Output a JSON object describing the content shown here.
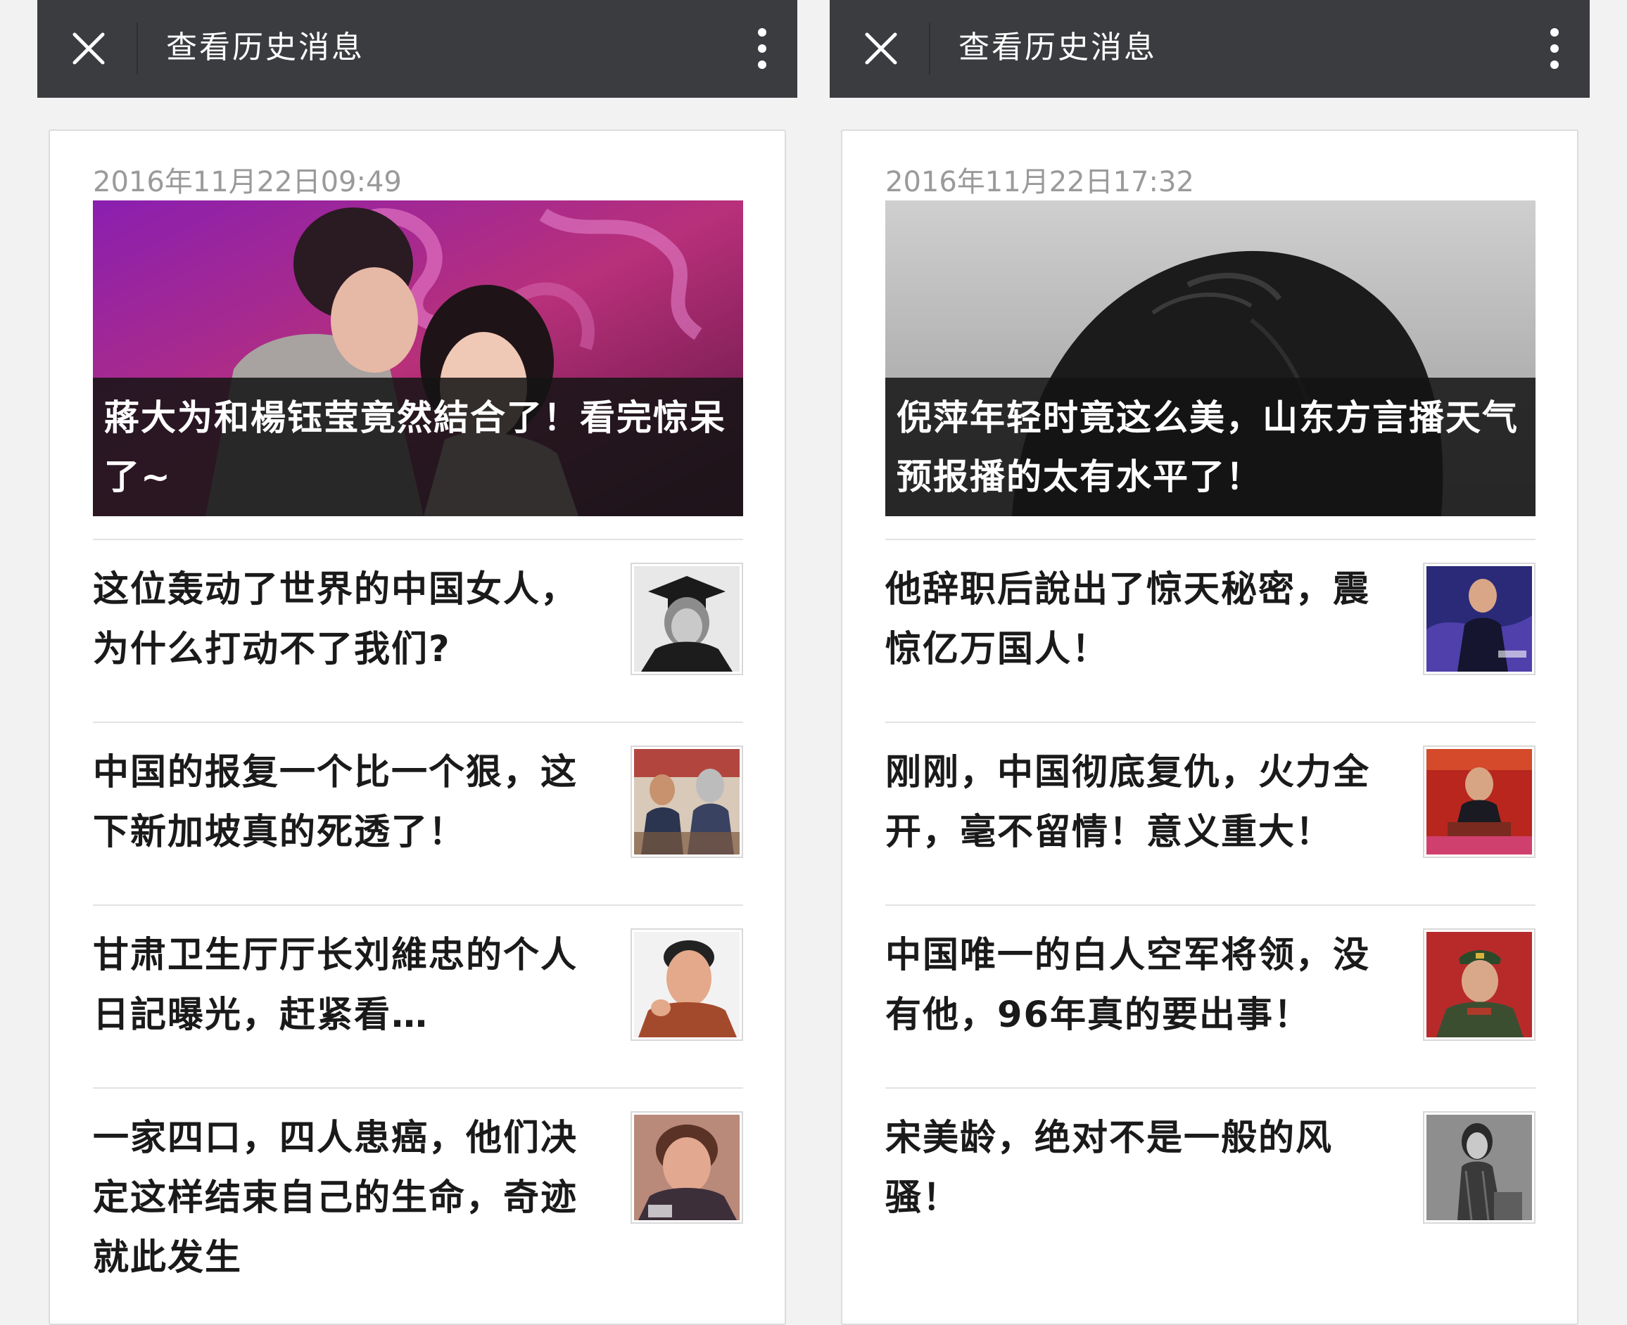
{
  "left": {
    "nav": {
      "title": "查看历史消息",
      "close_icon": "close-icon",
      "more_icon": "more-vertical-icon"
    },
    "date": "2016年11月22日09:49",
    "hero": {
      "title": "蔣大为和楊钰莹竟然結合了！看完惊呆了~"
    },
    "items": [
      {
        "title": "这位轰动了世界的中国女人，为什么打动不了我们?"
      },
      {
        "title": "中国的报复一个比一个狠，这下新加坡真的死透了！"
      },
      {
        "title": "甘肃卫生厅厅长刘維忠的个人日記曝光，赶紧看…"
      },
      {
        "title": "一家四口，四人患癌，他们决定这样结束自己的生命，奇迹就此发生"
      }
    ]
  },
  "right": {
    "nav": {
      "title": "查看历史消息",
      "close_icon": "close-icon",
      "more_icon": "more-vertical-icon"
    },
    "date": "2016年11月22日17:32",
    "hero": {
      "title": "倪萍年轻时竟这么美，山东方言播天气预报播的太有水平了！"
    },
    "items": [
      {
        "title": "他辞职后說出了惊天秘密，震惊亿万国人！"
      },
      {
        "title": "刚刚，中国彻底复仇，火力全开，毫不留情！意义重大！"
      },
      {
        "title": "中国唯一的白人空军将领，没有他，96年真的要出事！"
      },
      {
        "title": "宋美龄，绝对不是一般的风骚！"
      }
    ]
  },
  "colors": {
    "navbar": "#3b3c40",
    "background": "#f2f2f2",
    "date_text": "#9a9a9a",
    "title_text": "#1a1a1a",
    "caption_bg": "#141414"
  }
}
